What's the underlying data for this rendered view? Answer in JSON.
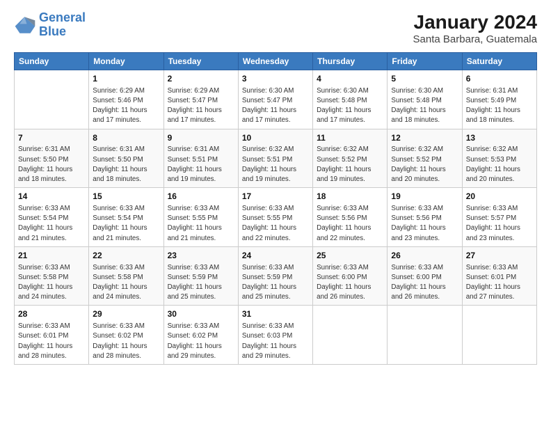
{
  "logo": {
    "line1": "General",
    "line2": "Blue"
  },
  "title": "January 2024",
  "subtitle": "Santa Barbara, Guatemala",
  "days_header": [
    "Sunday",
    "Monday",
    "Tuesday",
    "Wednesday",
    "Thursday",
    "Friday",
    "Saturday"
  ],
  "weeks": [
    [
      {
        "num": "",
        "info": ""
      },
      {
        "num": "1",
        "info": "Sunrise: 6:29 AM\nSunset: 5:46 PM\nDaylight: 11 hours\nand 17 minutes."
      },
      {
        "num": "2",
        "info": "Sunrise: 6:29 AM\nSunset: 5:47 PM\nDaylight: 11 hours\nand 17 minutes."
      },
      {
        "num": "3",
        "info": "Sunrise: 6:30 AM\nSunset: 5:47 PM\nDaylight: 11 hours\nand 17 minutes."
      },
      {
        "num": "4",
        "info": "Sunrise: 6:30 AM\nSunset: 5:48 PM\nDaylight: 11 hours\nand 17 minutes."
      },
      {
        "num": "5",
        "info": "Sunrise: 6:30 AM\nSunset: 5:48 PM\nDaylight: 11 hours\nand 18 minutes."
      },
      {
        "num": "6",
        "info": "Sunrise: 6:31 AM\nSunset: 5:49 PM\nDaylight: 11 hours\nand 18 minutes."
      }
    ],
    [
      {
        "num": "7",
        "info": "Sunrise: 6:31 AM\nSunset: 5:50 PM\nDaylight: 11 hours\nand 18 minutes."
      },
      {
        "num": "8",
        "info": "Sunrise: 6:31 AM\nSunset: 5:50 PM\nDaylight: 11 hours\nand 18 minutes."
      },
      {
        "num": "9",
        "info": "Sunrise: 6:31 AM\nSunset: 5:51 PM\nDaylight: 11 hours\nand 19 minutes."
      },
      {
        "num": "10",
        "info": "Sunrise: 6:32 AM\nSunset: 5:51 PM\nDaylight: 11 hours\nand 19 minutes."
      },
      {
        "num": "11",
        "info": "Sunrise: 6:32 AM\nSunset: 5:52 PM\nDaylight: 11 hours\nand 19 minutes."
      },
      {
        "num": "12",
        "info": "Sunrise: 6:32 AM\nSunset: 5:52 PM\nDaylight: 11 hours\nand 20 minutes."
      },
      {
        "num": "13",
        "info": "Sunrise: 6:32 AM\nSunset: 5:53 PM\nDaylight: 11 hours\nand 20 minutes."
      }
    ],
    [
      {
        "num": "14",
        "info": "Sunrise: 6:33 AM\nSunset: 5:54 PM\nDaylight: 11 hours\nand 21 minutes."
      },
      {
        "num": "15",
        "info": "Sunrise: 6:33 AM\nSunset: 5:54 PM\nDaylight: 11 hours\nand 21 minutes."
      },
      {
        "num": "16",
        "info": "Sunrise: 6:33 AM\nSunset: 5:55 PM\nDaylight: 11 hours\nand 21 minutes."
      },
      {
        "num": "17",
        "info": "Sunrise: 6:33 AM\nSunset: 5:55 PM\nDaylight: 11 hours\nand 22 minutes."
      },
      {
        "num": "18",
        "info": "Sunrise: 6:33 AM\nSunset: 5:56 PM\nDaylight: 11 hours\nand 22 minutes."
      },
      {
        "num": "19",
        "info": "Sunrise: 6:33 AM\nSunset: 5:56 PM\nDaylight: 11 hours\nand 23 minutes."
      },
      {
        "num": "20",
        "info": "Sunrise: 6:33 AM\nSunset: 5:57 PM\nDaylight: 11 hours\nand 23 minutes."
      }
    ],
    [
      {
        "num": "21",
        "info": "Sunrise: 6:33 AM\nSunset: 5:58 PM\nDaylight: 11 hours\nand 24 minutes."
      },
      {
        "num": "22",
        "info": "Sunrise: 6:33 AM\nSunset: 5:58 PM\nDaylight: 11 hours\nand 24 minutes."
      },
      {
        "num": "23",
        "info": "Sunrise: 6:33 AM\nSunset: 5:59 PM\nDaylight: 11 hours\nand 25 minutes."
      },
      {
        "num": "24",
        "info": "Sunrise: 6:33 AM\nSunset: 5:59 PM\nDaylight: 11 hours\nand 25 minutes."
      },
      {
        "num": "25",
        "info": "Sunrise: 6:33 AM\nSunset: 6:00 PM\nDaylight: 11 hours\nand 26 minutes."
      },
      {
        "num": "26",
        "info": "Sunrise: 6:33 AM\nSunset: 6:00 PM\nDaylight: 11 hours\nand 26 minutes."
      },
      {
        "num": "27",
        "info": "Sunrise: 6:33 AM\nSunset: 6:01 PM\nDaylight: 11 hours\nand 27 minutes."
      }
    ],
    [
      {
        "num": "28",
        "info": "Sunrise: 6:33 AM\nSunset: 6:01 PM\nDaylight: 11 hours\nand 28 minutes."
      },
      {
        "num": "29",
        "info": "Sunrise: 6:33 AM\nSunset: 6:02 PM\nDaylight: 11 hours\nand 28 minutes."
      },
      {
        "num": "30",
        "info": "Sunrise: 6:33 AM\nSunset: 6:02 PM\nDaylight: 11 hours\nand 29 minutes."
      },
      {
        "num": "31",
        "info": "Sunrise: 6:33 AM\nSunset: 6:03 PM\nDaylight: 11 hours\nand 29 minutes."
      },
      {
        "num": "",
        "info": ""
      },
      {
        "num": "",
        "info": ""
      },
      {
        "num": "",
        "info": ""
      }
    ]
  ]
}
